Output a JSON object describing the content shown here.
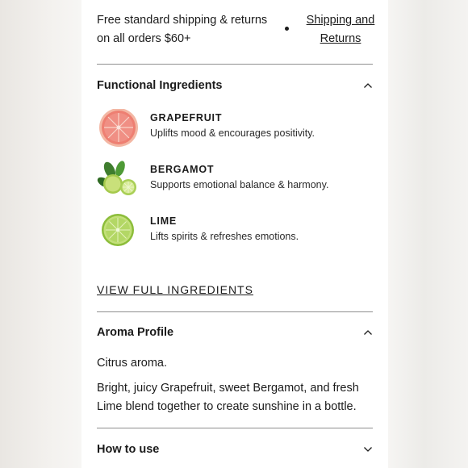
{
  "shipping": {
    "text": "Free standard shipping & returns on all orders $60+",
    "link": "Shipping and Returns"
  },
  "functional": {
    "title": "Functional Ingredients",
    "items": [
      {
        "name": "GRAPEFRUIT",
        "desc": "Uplifts mood & encourages positivity.",
        "icon": "grapefruit-slice"
      },
      {
        "name": "BERGAMOT",
        "desc": "Supports emotional balance & harmony.",
        "icon": "bergamot-with-leaves"
      },
      {
        "name": "LIME",
        "desc": "Lifts spirits & refreshes emotions.",
        "icon": "lime-slice"
      }
    ],
    "view_link": "VIEW FULL INGREDIENTS"
  },
  "aroma": {
    "title": "Aroma Profile",
    "short": "Citrus aroma.",
    "description": "Bright, juicy Grapefruit, sweet Bergamot, and fresh Lime blend together to create sunshine in a bottle."
  },
  "how_to_use": {
    "title": "How to use"
  },
  "colors": {
    "panel": "#ffffff",
    "text": "#1b1b1b",
    "divider": "#8f8f8f"
  }
}
